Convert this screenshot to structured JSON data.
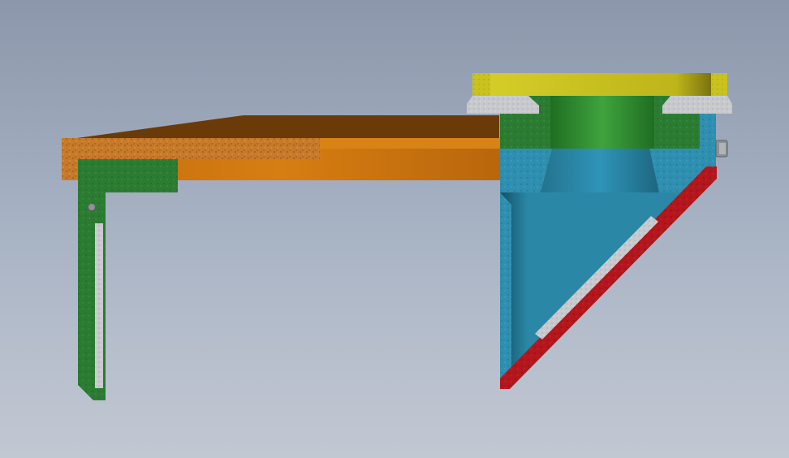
{
  "view": {
    "type": "cad-section-view",
    "background_colors": [
      "#8b97aa",
      "#c2c8d2"
    ]
  },
  "parts": [
    {
      "name": "top-plate",
      "color": "#c9c21f"
    },
    {
      "name": "gasket",
      "color": "#b7babf"
    },
    {
      "name": "hub",
      "color": "#2e8a2e"
    },
    {
      "name": "deck-top",
      "color": "#6b3a08"
    },
    {
      "name": "deck",
      "color": "#c9720f"
    },
    {
      "name": "left-bracket",
      "color": "#2b7c32"
    },
    {
      "name": "funnel-housing",
      "color": "#2b87a6"
    },
    {
      "name": "diagonal-plate",
      "color": "#b3161c"
    },
    {
      "name": "wear-strip",
      "color": "#c9c9c9"
    },
    {
      "name": "pin",
      "color": "#9a9a9a"
    }
  ]
}
